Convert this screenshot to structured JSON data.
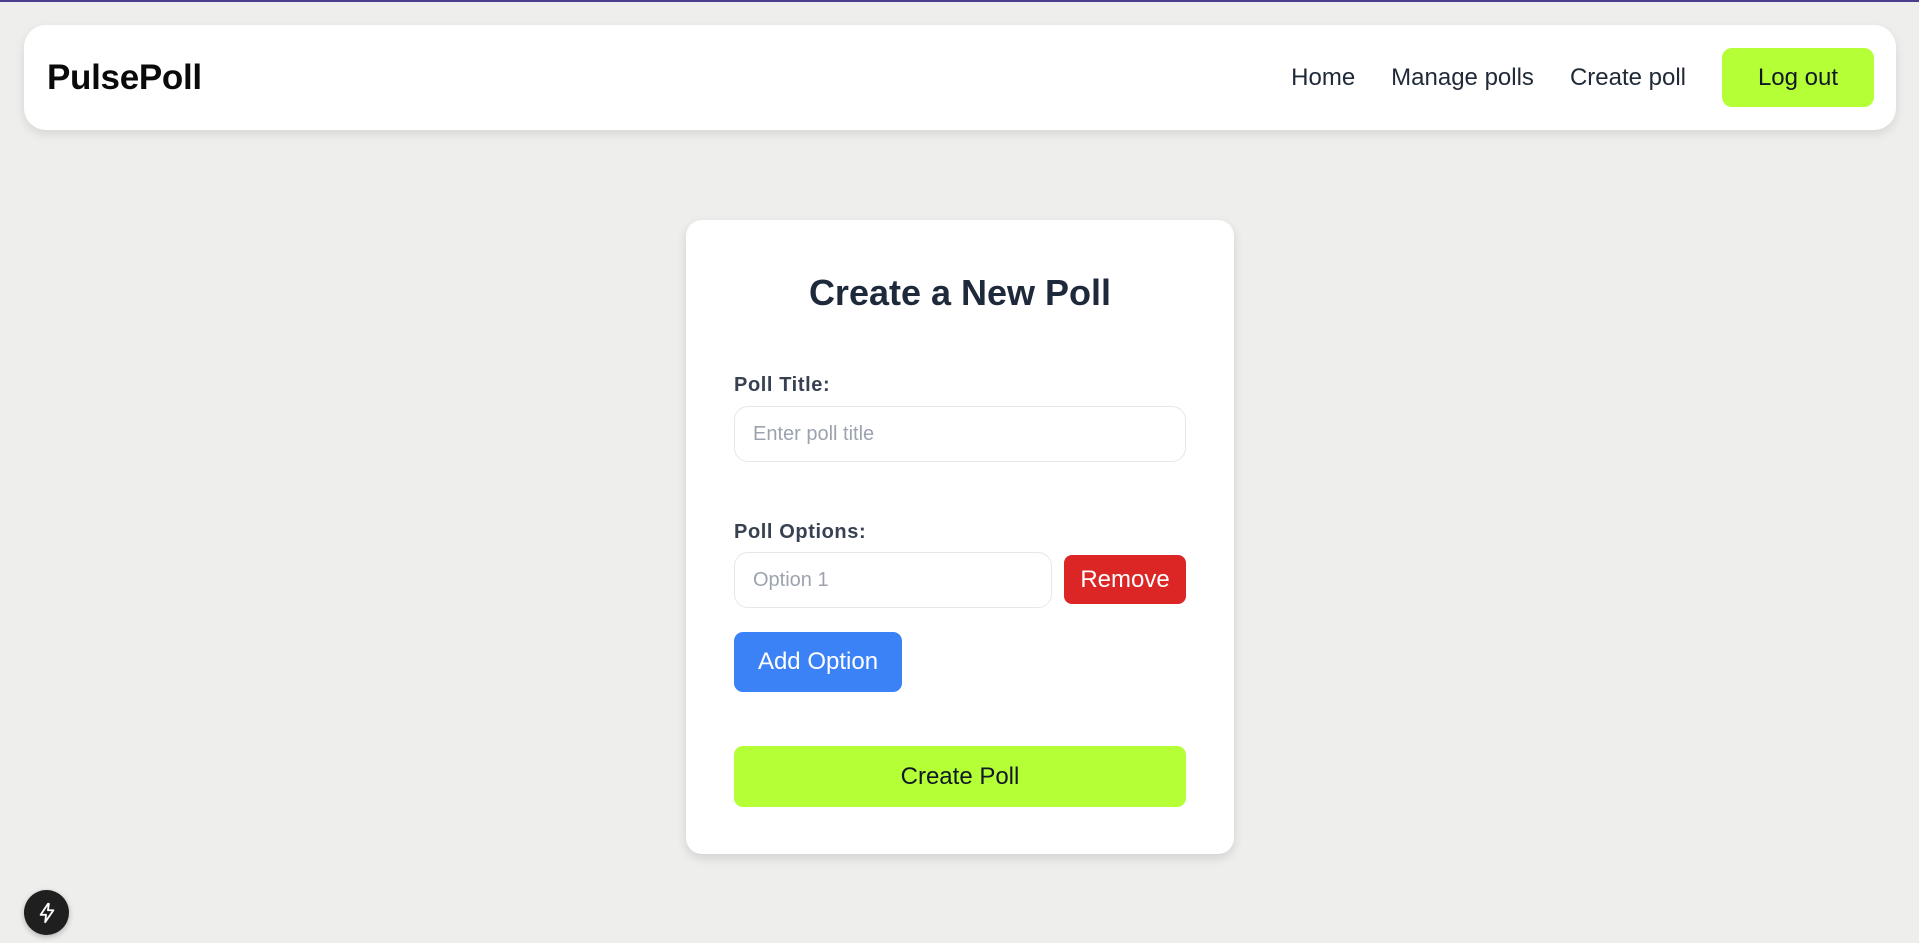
{
  "header": {
    "brand": "PulsePoll",
    "nav": [
      {
        "label": "Home"
      },
      {
        "label": "Manage polls"
      },
      {
        "label": "Create poll"
      }
    ],
    "logout_label": "Log out"
  },
  "form": {
    "title": "Create a New Poll",
    "poll_title_label": "Poll Title:",
    "poll_title_placeholder": "Enter poll title",
    "poll_title_value": "",
    "options_label": "Poll Options:",
    "options": [
      {
        "placeholder": "Option 1",
        "value": "",
        "remove_label": "Remove"
      }
    ],
    "add_option_label": "Add Option",
    "submit_label": "Create Poll"
  },
  "dev_indicator": {
    "icon": "lightning-bolt-icon"
  },
  "colors": {
    "accent": "#b4ff36",
    "danger": "#dc2626",
    "primary": "#3b82f6",
    "background": "#eeeeec"
  }
}
